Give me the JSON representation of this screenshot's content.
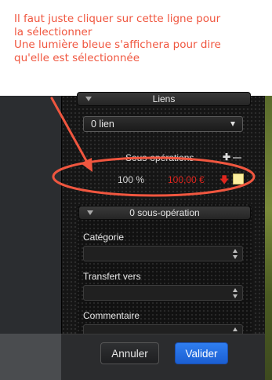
{
  "annotation": {
    "lines": [
      "Il faut juste cliquer sur cette ligne pour",
      "la sélectionner",
      "Une lumière bleue s'affichera pour dire",
      "qu'elle est sélectionnée"
    ],
    "color": "#f0563f"
  },
  "liens": {
    "title": "Liens",
    "select_value": "0 lien"
  },
  "sous_operations": {
    "title": "Sous-opérations",
    "add_icon": "plus-icon",
    "remove_icon": "minus-icon",
    "rows": [
      {
        "percent": "100 %",
        "amount": "100,00 €",
        "direction_icon": "arrow-down-icon",
        "color": "#fbefa0"
      }
    ]
  },
  "detail": {
    "title": "0 sous-opération",
    "fields": [
      {
        "label": "Catégorie",
        "value": ""
      },
      {
        "label": "Transfert vers",
        "value": ""
      },
      {
        "label": "Commentaire",
        "value": ""
      }
    ]
  },
  "footer": {
    "cancel_label": "Annuler",
    "ok_label": "Valider",
    "accent": "#1b5fd2"
  }
}
